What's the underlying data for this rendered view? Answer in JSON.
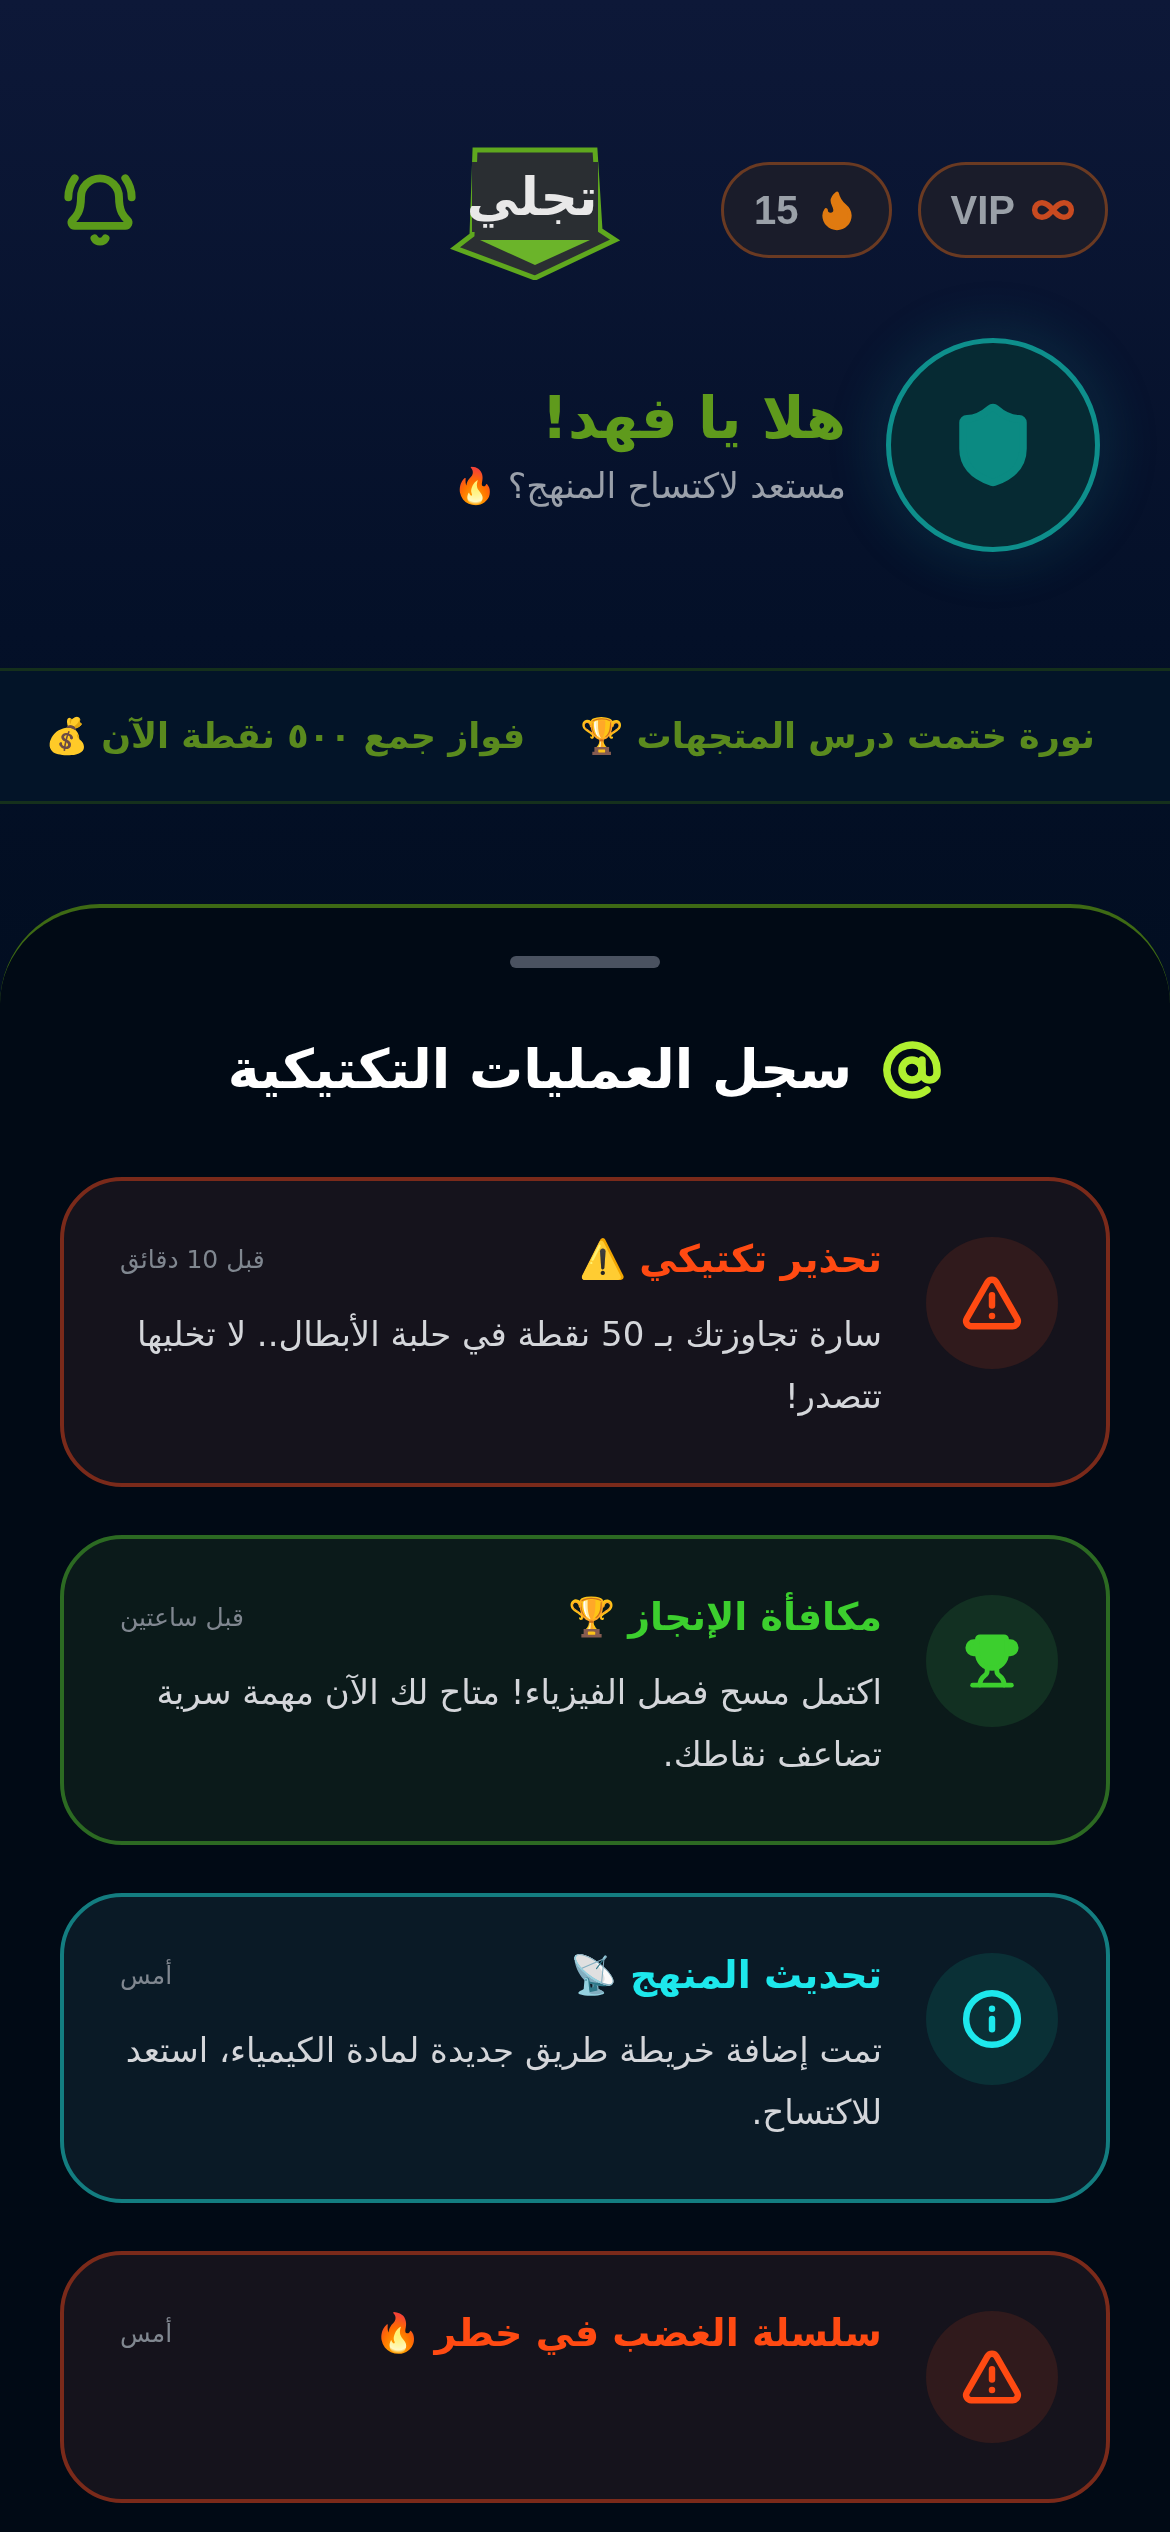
{
  "header": {
    "logo": "تجلي",
    "streak": "15",
    "vip": "VIP"
  },
  "hero": {
    "title": "هلا يا فهد!",
    "subtitle": "مستعد لاكتساح المنهج؟ 🔥"
  },
  "ticker": [
    "نورة ختمت درس المتجهات 🏆",
    "فواز جمع ٥٠٠ نقطة الآن 💰"
  ],
  "sheet": {
    "title": "سجل العمليات التكتيكية",
    "cards": [
      {
        "kind": "warning",
        "title": "تحذير تكتيكي ⚠️",
        "time": "قبل 10 دقائق",
        "body": "سارة تجاوزتك بـ 50 نقطة في حلبة الأبطال.. لا تخليها تتصدر!"
      },
      {
        "kind": "reward",
        "title": "مكافأة الإنجاز 🏆",
        "time": "قبل ساعتين",
        "body": "اكتمل مسح فصل الفيزياء! متاح لك الآن مهمة سرية تضاعف نقاطك."
      },
      {
        "kind": "info",
        "title": "تحديث المنهج 📡",
        "time": "أمس",
        "body": "تمت إضافة خريطة طريق جديدة لمادة الكيمياء، استعد للاكتساح."
      },
      {
        "kind": "warning",
        "title": "سلسلة الغضب في خطر 🔥",
        "time": "أمس"
      }
    ]
  }
}
